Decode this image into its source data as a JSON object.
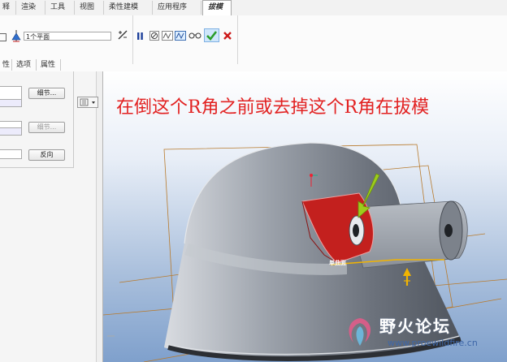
{
  "menu": {
    "tabs": [
      "释",
      "渲染",
      "工具",
      "视图",
      "柔性建模",
      "应用程序"
    ],
    "active_tab": "拔模"
  },
  "ribbon": {
    "surface_field": "1个平面"
  },
  "subtabs": [
    "选项",
    "属性"
  ],
  "panel": {
    "details_1": "细节...",
    "details_2": "细节...",
    "reverse": "反向"
  },
  "viewport": {
    "caption": "在倒这个R角之前或去掉这个R角在拔模",
    "feature_tag": "单曲面",
    "watermark_cn": "野火论坛",
    "watermark_url": "www.proewildfire.cn"
  },
  "colors": {
    "caption": "#e22222",
    "highlight": "#c3201e",
    "arrow": "#9ccc1c",
    "confirm": "#2a9d2a",
    "cancel": "#cc1a1a"
  }
}
